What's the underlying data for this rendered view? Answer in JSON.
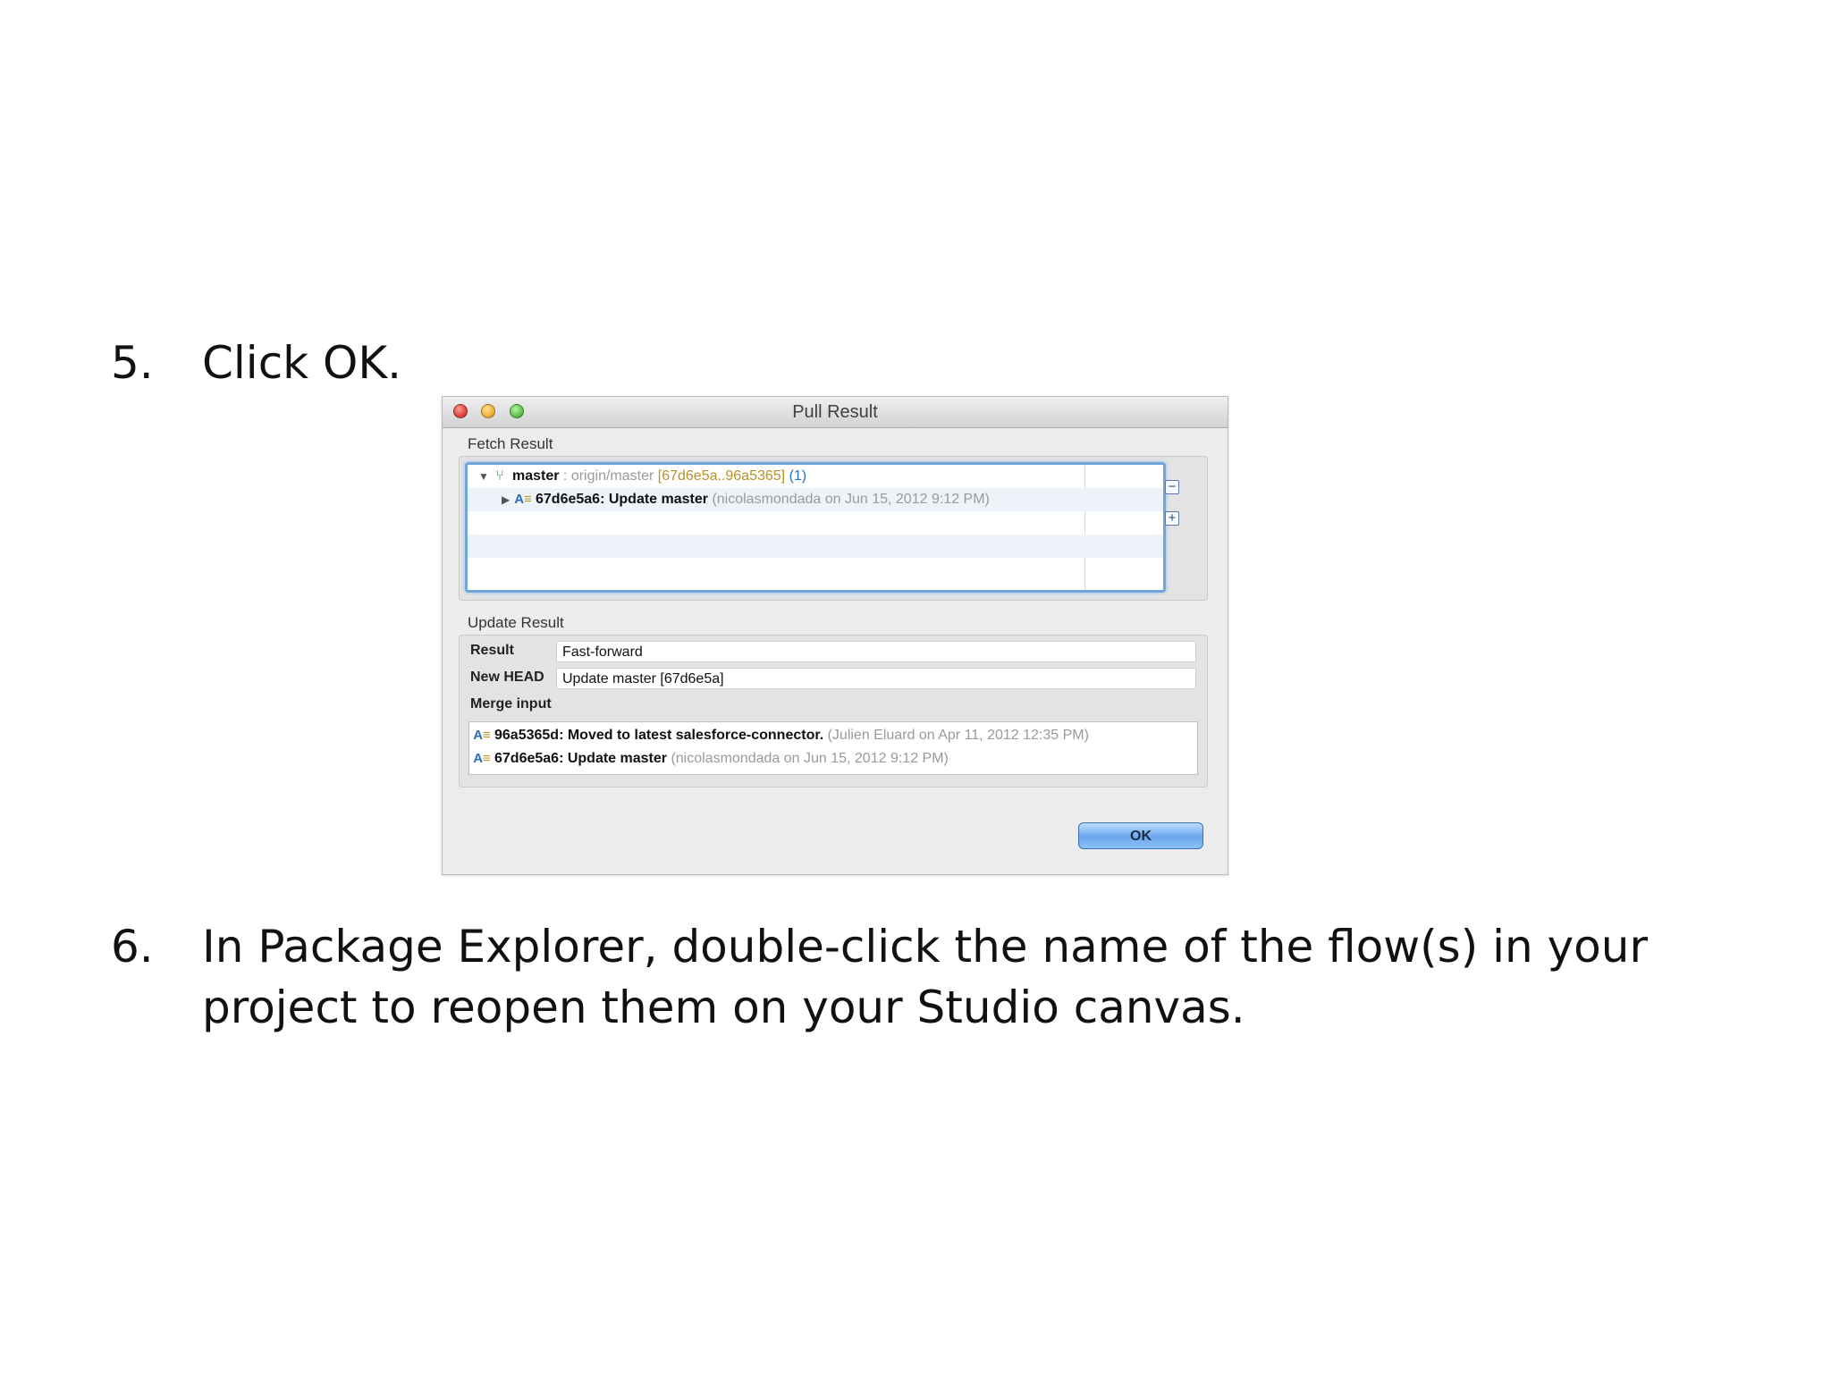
{
  "steps": [
    {
      "number": "5.",
      "text": "Click OK."
    },
    {
      "number": "6.",
      "text": "In Package Explorer, double-click the name of the flow(s) in your project to reopen them on your Studio canvas."
    }
  ],
  "dialog": {
    "title": "Pull Result",
    "fetch_result": {
      "label": "Fetch Result",
      "branch": {
        "name": "master",
        "separator": " : ",
        "tracking": "origin/master",
        "range": "[67d6e5a..96a5365]",
        "count": "(1)"
      },
      "commit": {
        "id_message": "67d6e5a6: Update master",
        "meta": "(nicolasmondada on Jun 15, 2012 9:12 PM)"
      },
      "collapse_icon": "collapse-all-icon",
      "expand_icon": "expand-all-icon"
    },
    "update_result": {
      "label": "Update Result",
      "result_label": "Result",
      "result_value": "Fast-forward",
      "head_label": "New HEAD",
      "head_value": "Update master [67d6e5a]",
      "merge_label": "Merge input",
      "merge_items": [
        {
          "id_message": "96a5365d: Moved to latest salesforce-connector.",
          "meta": "(Julien Eluard on Apr 11, 2012 12:35 PM)"
        },
        {
          "id_message": "67d6e5a6: Update master",
          "meta": "(nicolasmondada on Jun 15, 2012 9:12 PM)"
        }
      ]
    },
    "ok_label": "OK",
    "colors": {
      "accent": "#6fa5dc",
      "button": "#6aa7ee"
    }
  }
}
